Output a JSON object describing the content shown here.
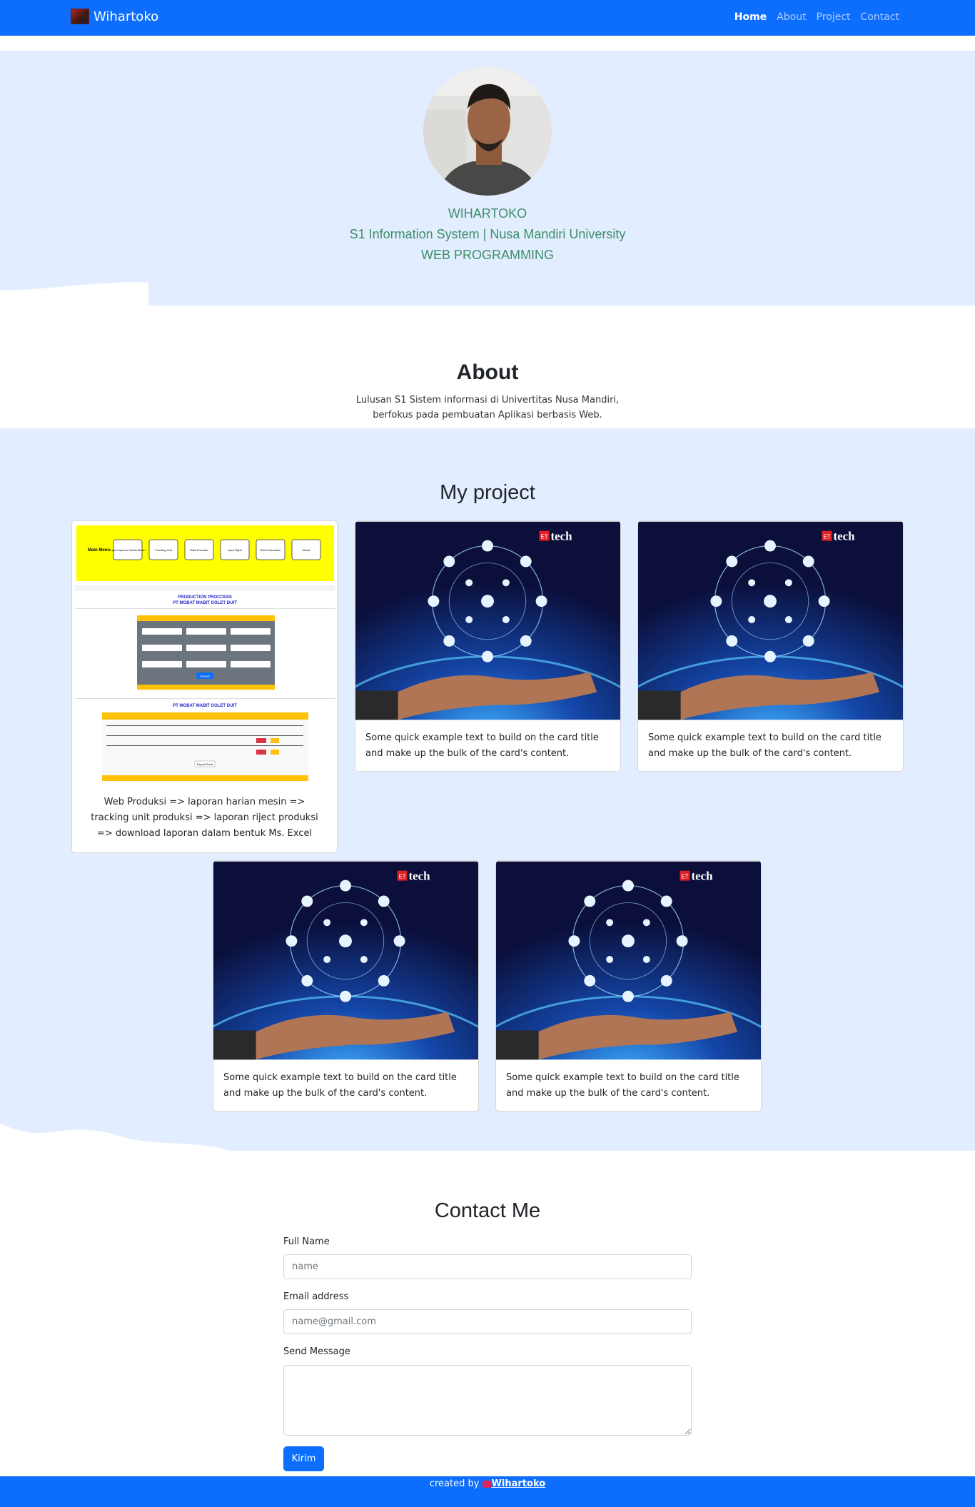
{
  "nav": {
    "brand": "Wihartoko",
    "links": [
      "Home",
      "About",
      "Project",
      "Contact"
    ]
  },
  "hero": {
    "name": "WIHARTOKO",
    "subtitle": "S1 Information System | Nusa Mandiri University",
    "tagline": "WEB PROGRAMMING"
  },
  "about": {
    "title": "About",
    "line1": "Lulusan S1 Sistem informasi di Univertitas Nusa Mandiri,",
    "line2": "berfokus pada pembuatan Aplikasi berbasis Web."
  },
  "projects": {
    "title": "My project",
    "cards": [
      {
        "text": "Web Produksi => laporan harian mesin => tracking unit produksi => laporan riject produksi => download laporan dalam bentuk Ms. Excel"
      },
      {
        "text": "Some quick example text to build on the card title and make up the bulk of the card's content.",
        "badge": "tech",
        "badge_mark": "ET"
      },
      {
        "text": "Some quick example text to build on the card title and make up the bulk of the card's content.",
        "badge": "tech",
        "badge_mark": "ET"
      },
      {
        "text": "Some quick example text to build on the card title and make up the bulk of the card's content.",
        "badge": "tech",
        "badge_mark": "ET"
      },
      {
        "text": "Some quick example text to build on the card title and make up the bulk of the card's content.",
        "badge": "tech",
        "badge_mark": "ET"
      }
    ],
    "mockup": {
      "menu_title": "Main Menu",
      "menu_buttons": [
        "Input Laporan Harian Mesin",
        "Tracking Unit",
        "Data Produksi",
        "Input Riject",
        "Work Instruction",
        "About"
      ],
      "heading1": "PRODUCTION PROCCESS",
      "heading2": "PT MOBAT MABIT GOLET DUIT",
      "submit": "Simpan",
      "heading3": "PT MOBAT MABIT GOLET DUIT",
      "export": "Export Excel"
    }
  },
  "contact": {
    "title": "Contact Me",
    "name_label": "Full Name",
    "name_placeholder": "name",
    "email_label": "Email address",
    "email_placeholder": "name@gmail.com",
    "message_label": "Send Message",
    "submit_label": "Kirim"
  },
  "footer": {
    "prefix": "created by",
    "author": "Wihartoko"
  },
  "colors": {
    "primary": "#0d6efd",
    "hero_bg": "#e2edff",
    "hero_text": "#3f8f6a"
  }
}
